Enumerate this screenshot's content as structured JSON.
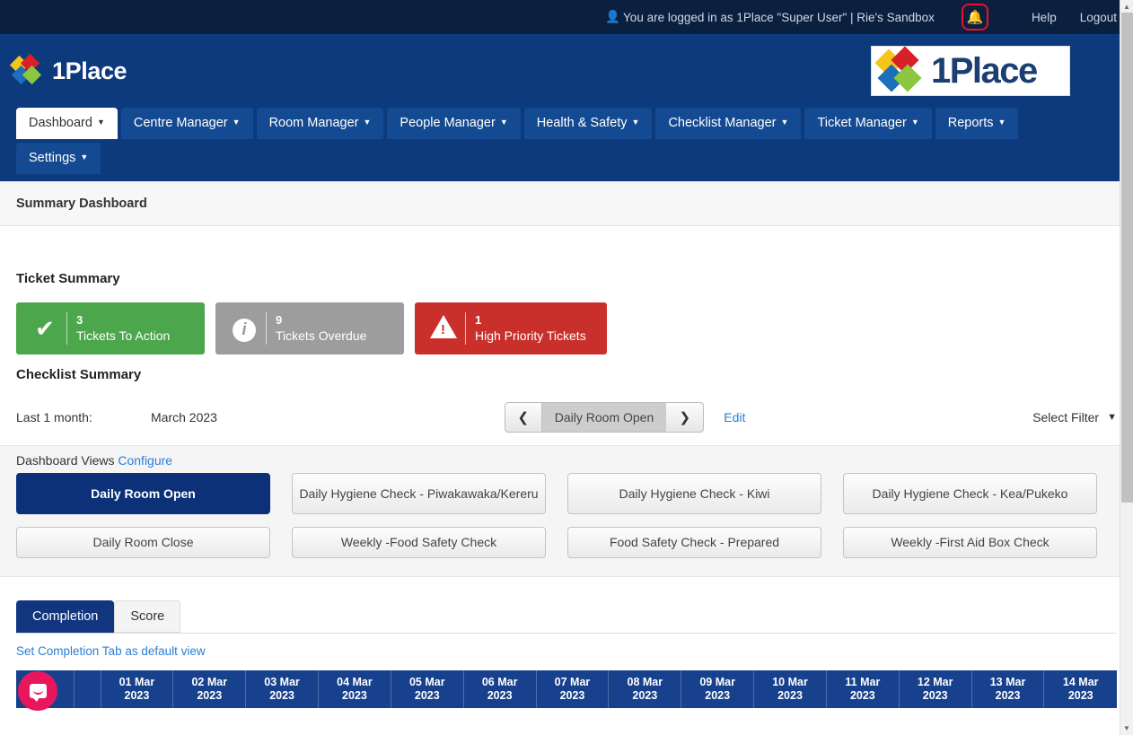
{
  "topbar": {
    "user_icon": "user-icon",
    "logged_in_text": "You are logged in as  1Place \"Super User\"  |  Rie's Sandbox",
    "bell_icon": "bell-icon",
    "help_label": "Help",
    "logout_label": "Logout"
  },
  "brand": {
    "name": "1Place",
    "client_logo_name": "1Place"
  },
  "nav": {
    "items": [
      {
        "label": "Dashboard",
        "caret": true,
        "active": true
      },
      {
        "label": "Centre Manager",
        "caret": true,
        "active": false
      },
      {
        "label": "Room Manager",
        "caret": true,
        "active": false
      },
      {
        "label": "People Manager",
        "caret": true,
        "active": false
      },
      {
        "label": "Health & Safety",
        "caret": true,
        "active": false
      },
      {
        "label": "Checklist Manager",
        "caret": true,
        "active": false
      },
      {
        "label": "Ticket Manager",
        "caret": true,
        "active": false
      },
      {
        "label": "Reports",
        "caret": true,
        "active": false
      },
      {
        "label": "Settings",
        "caret": true,
        "active": false
      }
    ]
  },
  "page": {
    "title": "Summary Dashboard"
  },
  "ticket_summary": {
    "title": "Ticket Summary",
    "tiles": [
      {
        "icon": "check-icon",
        "count": "3",
        "label": "Tickets To Action",
        "color": "#4ca64c"
      },
      {
        "icon": "info-icon",
        "count": "9",
        "label": "Tickets Overdue",
        "color": "#9d9d9d"
      },
      {
        "icon": "warning-icon",
        "count": "1",
        "label": "High Priority Tickets",
        "color": "#c9302c"
      }
    ]
  },
  "checklist_summary": {
    "title": "Checklist Summary",
    "period_label": "Last 1 month:",
    "period_value": "March 2023",
    "pager": {
      "prev_icon": "chevron-left-icon",
      "current": "Daily Room Open",
      "next_icon": "chevron-right-icon"
    },
    "edit_label": "Edit",
    "filter_label": "Select Filter",
    "filter_chevron_icon": "chevron-down-icon"
  },
  "dashboard_views": {
    "heading": "Dashboard Views",
    "configure_label": "Configure",
    "buttons": [
      {
        "label": "Daily Room Open",
        "active": true,
        "tall": false
      },
      {
        "label": "Daily Hygiene Check - Piwakawaka/Kereru",
        "active": false,
        "tall": true
      },
      {
        "label": "Daily Hygiene Check - Kiwi",
        "active": false,
        "tall": false
      },
      {
        "label": "Daily Hygiene Check - Kea/Pukeko",
        "active": false,
        "tall": false
      },
      {
        "label": "Daily Room Close",
        "active": false,
        "tall": false
      },
      {
        "label": "Weekly -Food Safety Check",
        "active": false,
        "tall": false
      },
      {
        "label": "Food Safety Check - Prepared",
        "active": false,
        "tall": false
      },
      {
        "label": "Weekly -First Aid Box Check",
        "active": false,
        "tall": false
      }
    ]
  },
  "tabs": {
    "items": [
      {
        "label": "Completion",
        "active": true
      },
      {
        "label": "Score",
        "active": false
      }
    ],
    "default_view_link": "Set Completion Tab as default view"
  },
  "table": {
    "columns": [
      "01 Mar 2023",
      "02 Mar 2023",
      "03 Mar 2023",
      "04 Mar 2023",
      "05 Mar 2023",
      "06 Mar 2023",
      "07 Mar 2023",
      "08 Mar 2023",
      "09 Mar 2023",
      "10 Mar 2023",
      "11 Mar 2023",
      "12 Mar 2023",
      "13 Mar 2023",
      "14 Mar 2023"
    ]
  },
  "chat": {
    "launcher_icon": "chat-bubble-icon"
  },
  "scrollbar": {
    "up_icon": "scroll-up-icon",
    "down_icon": "scroll-down-icon"
  },
  "colors": {
    "topbar": "#0b1f3f",
    "header": "#0d3a7d",
    "accent_blue": "#12357f",
    "link": "#2a7fd4",
    "green": "#4ca64c",
    "grey": "#9d9d9d",
    "red": "#c9302c",
    "bell_ring": "#e8112d",
    "chat": "#e8175d"
  }
}
